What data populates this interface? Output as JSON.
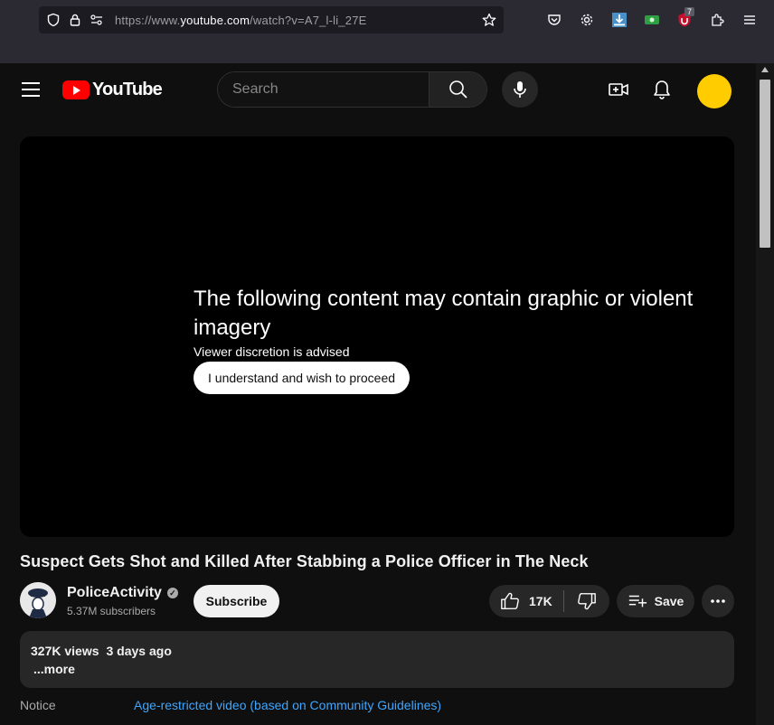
{
  "browser": {
    "url_prefix": "https://www.",
    "url_host": "youtube.com",
    "url_path": "/watch?v=A7_l-li_27E",
    "extension_badge": "7",
    "icons": [
      "shield-icon",
      "lock-icon",
      "page-settings-icon",
      "bookmark-star-icon",
      "pocket-icon",
      "settings-gear-icon",
      "download-icon",
      "extension-green-icon",
      "ublock-icon",
      "extensions-puzzle-icon",
      "menu-icon"
    ]
  },
  "header": {
    "logo_text": "YouTube",
    "search_placeholder": "Search",
    "icons": [
      "menu-icon",
      "search-icon",
      "mic-icon",
      "create-video-icon",
      "notifications-bell-icon"
    ],
    "avatar_color": "#ffcc00",
    "brand_color": "#ff0000"
  },
  "player": {
    "warning_title": "The following content may contain graphic or violent imagery",
    "warning_subtitle": "Viewer discretion is advised",
    "proceed_label": "I understand and wish to proceed"
  },
  "video": {
    "title": "Suspect Gets Shot and Killed After Stabbing a Police Officer in The Neck",
    "channel_name": "PoliceActivity",
    "subscribers": "5.37M subscribers",
    "subscribe_label": "Subscribe",
    "likes": "17K",
    "save_label": "Save",
    "views": "327K views",
    "uploaded": "3 days ago",
    "more_label": "...more",
    "notice_label": "Notice",
    "notice_text": "Age-restricted video (based on Community Guidelines)"
  }
}
